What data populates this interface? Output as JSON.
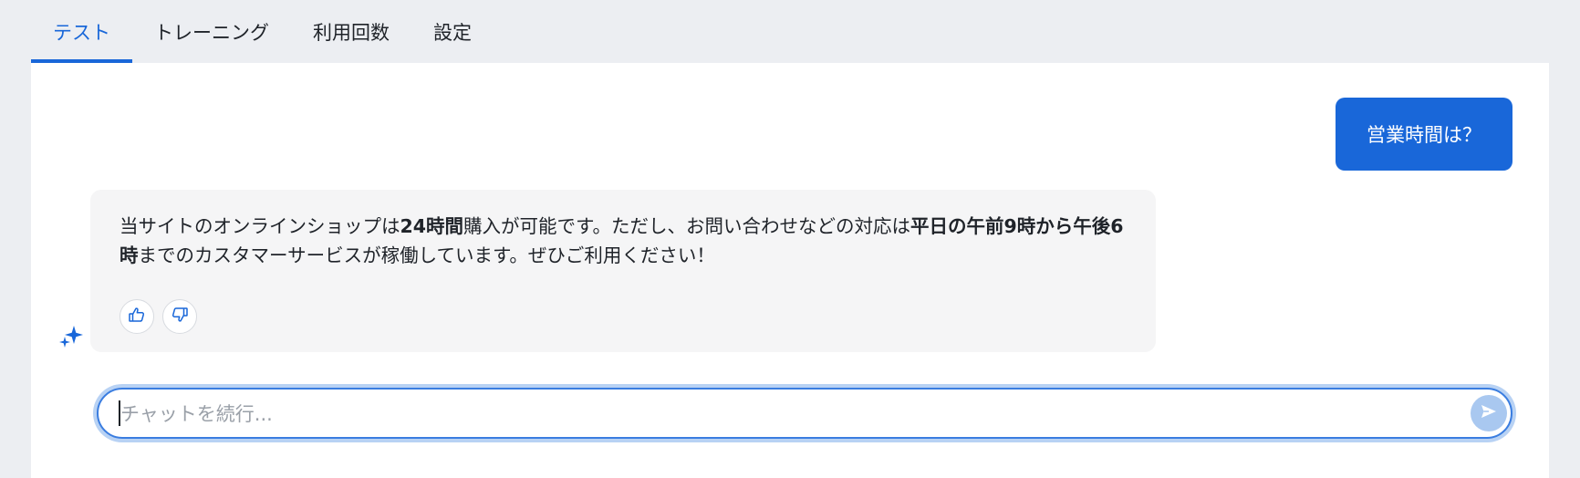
{
  "tabs": [
    {
      "label": "テスト",
      "active": true
    },
    {
      "label": "トレーニング",
      "active": false
    },
    {
      "label": "利用回数",
      "active": false
    },
    {
      "label": "設定",
      "active": false
    }
  ],
  "chat": {
    "user_message": "営業時間は？",
    "ai_message": {
      "part1": "当サイトのオンラインショップは",
      "bold1": "24時間",
      "part2": "購入が可能です。ただし、お問い合わせなどの対応は",
      "bold2": "平日の午前9時から午後6時",
      "part3": "までのカスタマーサービスが稼働しています。ぜひご利用ください！"
    },
    "input_placeholder": "チャットを続行...",
    "input_value": ""
  },
  "icons": {
    "ai": "sparkle-icon",
    "like": "thumbs-up-icon",
    "dislike": "thumbs-down-icon",
    "send": "send-icon"
  },
  "colors": {
    "accent": "#1967d9",
    "background": "#eceef2",
    "panel": "#ffffff",
    "ai_bubble": "#f5f5f6",
    "send_button": "#a9c8f0"
  }
}
